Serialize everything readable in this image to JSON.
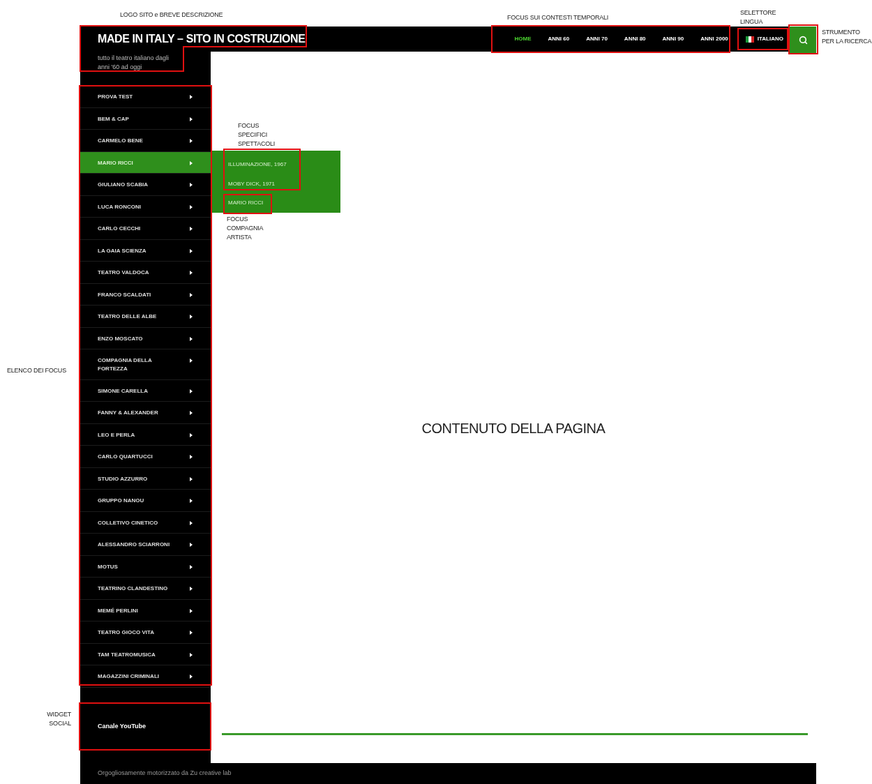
{
  "annotations": {
    "logo": "LOGO SITO e BREVE DESCRIZIONE",
    "periods": "FOCUS SUI CONTESTI TEMPORALI",
    "language": "SELETTORE LINGUA",
    "search": "STRUMENTO PER LA RICERCA",
    "shows": "FOCUS SPECIFICI SPETTACOLI",
    "company": "FOCUS COMPAGNIA ARTISTA",
    "list": "ELENCO DEI FOCUS",
    "social": "WIDGET SOCIAL"
  },
  "header": {
    "title": "MADE IN ITALY – SITO IN COSTRUZIONE",
    "nav": [
      {
        "label": "HOME",
        "selected": true
      },
      {
        "label": "ANNI 60",
        "selected": false
      },
      {
        "label": "ANNI 70",
        "selected": false
      },
      {
        "label": "ANNI 80",
        "selected": false
      },
      {
        "label": "ANNI 90",
        "selected": false
      },
      {
        "label": "ANNI 2000",
        "selected": false
      }
    ],
    "language": "ITALIANO"
  },
  "sidebar": {
    "tagline": "tutto il teatro italiano dagli anni '60 ad oggi",
    "items": [
      {
        "label": "PROVA TEST",
        "selected": false
      },
      {
        "label": "BEM & CAP",
        "selected": false
      },
      {
        "label": "CARMELO BENE",
        "selected": false
      },
      {
        "label": "MARIO RICCI",
        "selected": true
      },
      {
        "label": "GIULIANO SCABIA",
        "selected": false
      },
      {
        "label": "LUCA RONCONI",
        "selected": false
      },
      {
        "label": "CARLO CECCHI",
        "selected": false
      },
      {
        "label": "LA GAIA SCIENZA",
        "selected": false
      },
      {
        "label": "TEATRO VALDOCA",
        "selected": false
      },
      {
        "label": "FRANCO SCALDATI",
        "selected": false
      },
      {
        "label": "TEATRO DELLE ALBE",
        "selected": false
      },
      {
        "label": "ENZO MOSCATO",
        "selected": false
      },
      {
        "label": "COMPAGNIA DELLA FORTEZZA",
        "selected": false
      },
      {
        "label": "SIMONE CARELLA",
        "selected": false
      },
      {
        "label": "FANNY & ALEXANDER",
        "selected": false
      },
      {
        "label": "LEO E PERLA",
        "selected": false
      },
      {
        "label": "CARLO QUARTUCCI",
        "selected": false
      },
      {
        "label": "STUDIO AZZURRO",
        "selected": false
      },
      {
        "label": "GRUPPO NANOU",
        "selected": false
      },
      {
        "label": "COLLETIVO CINETICO",
        "selected": false
      },
      {
        "label": "ALESSANDRO SCIARRONI",
        "selected": false
      },
      {
        "label": "MOTUS",
        "selected": false
      },
      {
        "label": "TEATRINO CLANDESTINO",
        "selected": false
      },
      {
        "label": "MEMÉ PERLINI",
        "selected": false
      },
      {
        "label": "TEATRO GIOCO VITA",
        "selected": false
      },
      {
        "label": "TAM TEATROMUSICA",
        "selected": false
      },
      {
        "label": "MAGAZZINI CRIMINALI",
        "selected": false
      }
    ],
    "submenu": [
      "ILLUMINAZIONE, 1967",
      "MOBY DICK, 1971",
      "MARIO RICCI"
    ],
    "widget_title": "Canale YouTube"
  },
  "content": {
    "placeholder_text": "CONTENUTO DELLA PAGINA"
  },
  "footer": "Orgogliosamente motorizzato da Zu creative lab"
}
